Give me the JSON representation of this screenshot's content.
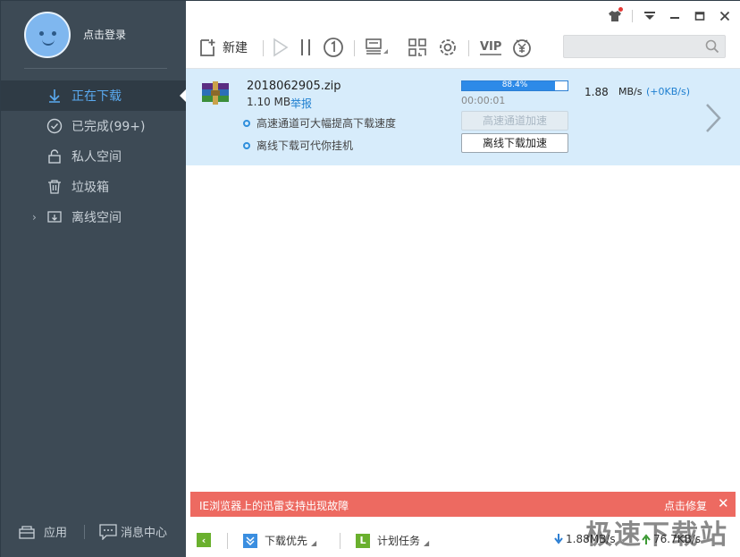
{
  "user": {
    "login_label": "点击登录"
  },
  "sidebar": {
    "items": [
      {
        "label": "正在下载",
        "icon": "download-arrow-icon",
        "active": true
      },
      {
        "label": "已完成(99+)",
        "icon": "check-circle-icon",
        "active": false
      },
      {
        "label": "私人空间",
        "icon": "lock-icon",
        "active": false
      },
      {
        "label": "垃圾箱",
        "icon": "trash-icon",
        "active": false
      },
      {
        "label": "离线空间",
        "icon": "cloud-download-icon",
        "active": false
      }
    ],
    "bottom": {
      "apps_label": "应用",
      "messages_label": "消息中心"
    }
  },
  "toolbar": {
    "new_label": "新建",
    "vip_label": "VIP"
  },
  "task": {
    "file_name": "2018062905.zip",
    "file_size": "1.10 MB",
    "report_label": "举报",
    "progress_text": "88.4%",
    "progress_value": 0.884,
    "elapsed": "00:00:01",
    "speed_value": "1.88",
    "speed_unit": "MB/s",
    "speed_extra": "(+0KB/s)",
    "tip_highspeed": "高速通道可大幅提高下载速度",
    "tip_offline": "离线下载可代你挂机",
    "highspeed_button": "高速通道加速",
    "offline_button": "离线下载加速"
  },
  "notice": {
    "text": "IE浏览器上的迅雷支持出现故障",
    "fix_label": "点击修复"
  },
  "statusbar": {
    "download_priority": "下载优先",
    "plan_task": "计划任务",
    "download_speed": "1.88MB/s",
    "upload_speed": "76.7KB/s"
  },
  "watermark": "极速下载站",
  "colors": {
    "sidebar_bg": "#3d4a55",
    "active_blue": "#5aaaf0",
    "task_row_bg": "#d7ecfb",
    "notice_bg": "#ed6a61",
    "progress": "#2d8ae8"
  }
}
